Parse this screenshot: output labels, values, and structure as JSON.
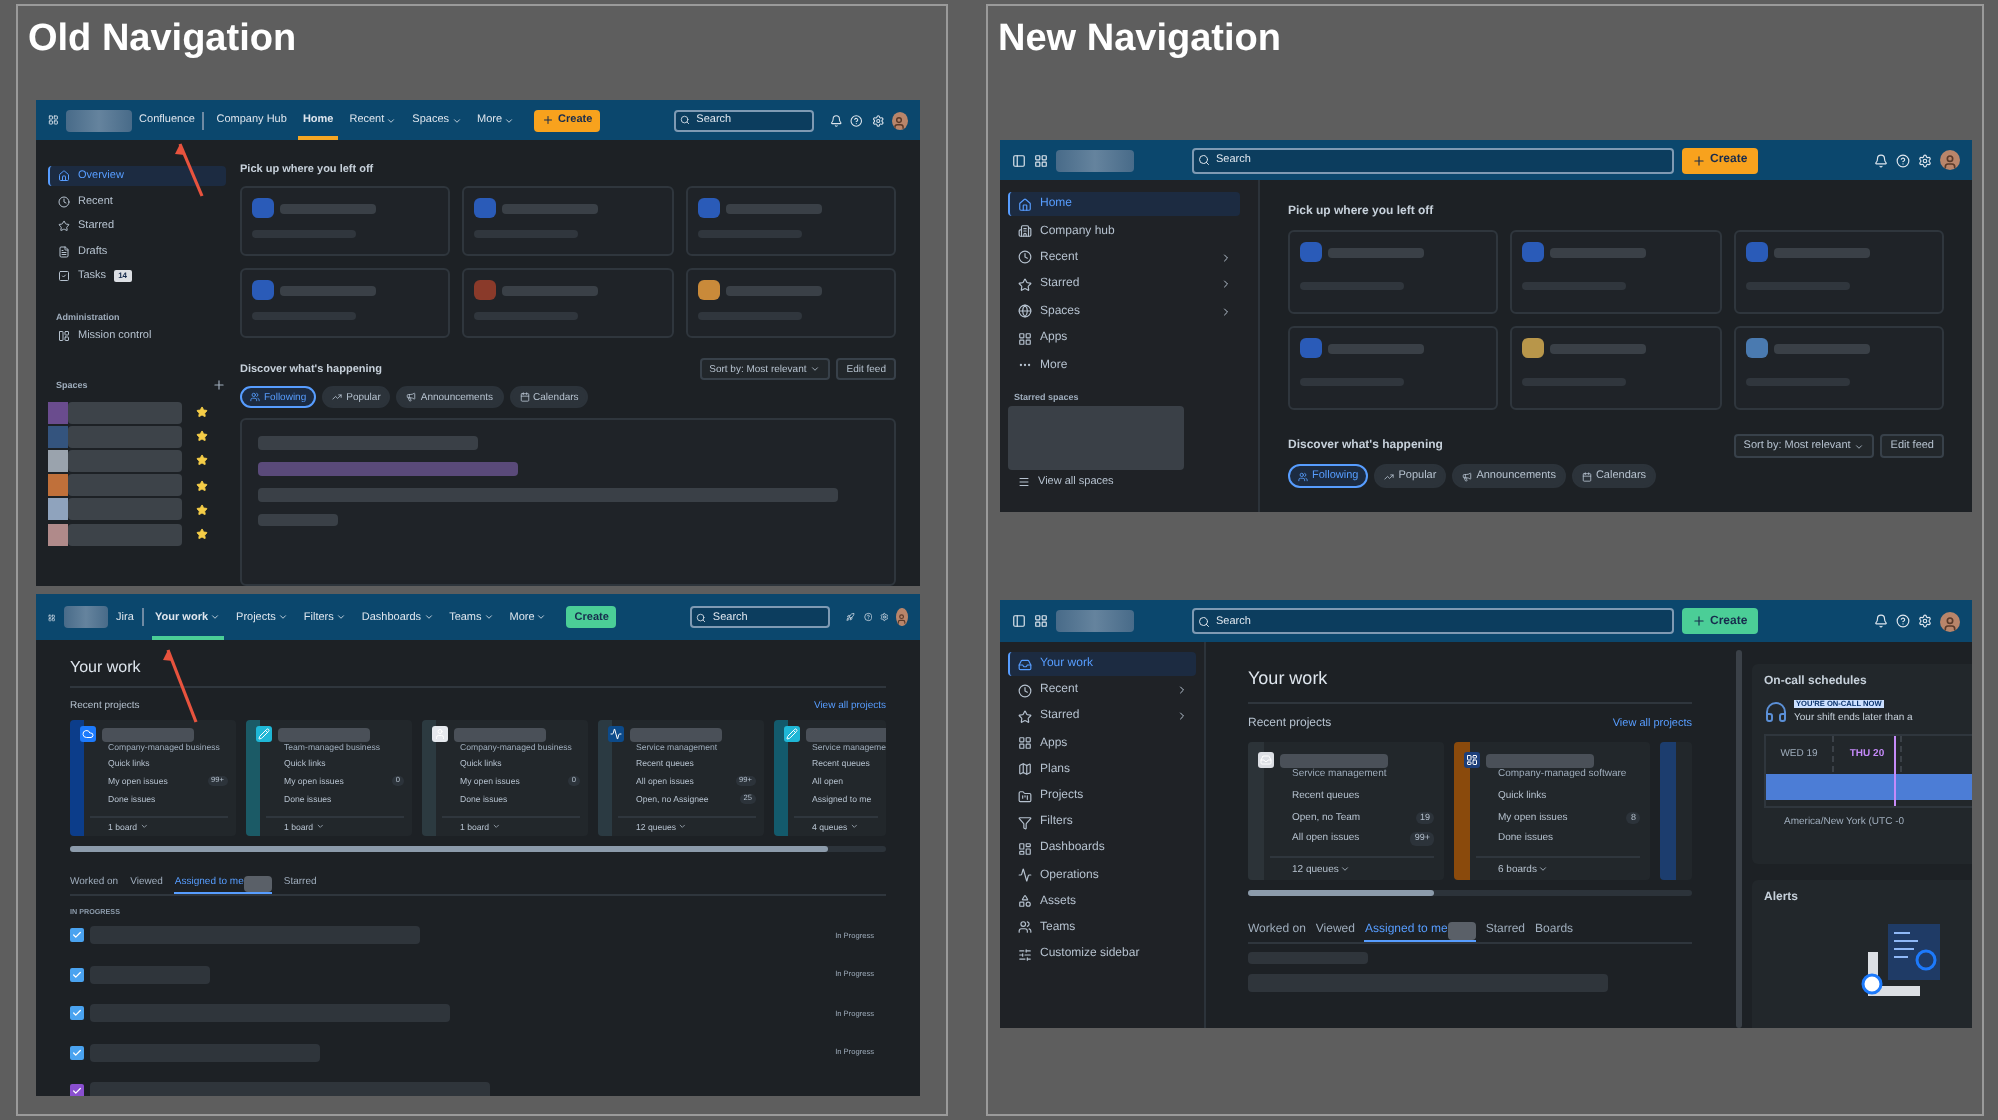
{
  "old_navigation": {
    "title": "Old Navigation",
    "confluence": {
      "top_nav": {
        "product": "Confluence",
        "items": [
          {
            "label": "Company Hub",
            "selected": false,
            "dropdown": false
          },
          {
            "label": "Home",
            "selected": true,
            "dropdown": false
          },
          {
            "label": "Recent",
            "selected": false,
            "dropdown": true
          },
          {
            "label": "Spaces",
            "selected": false,
            "dropdown": true
          },
          {
            "label": "More",
            "selected": false,
            "dropdown": true
          }
        ],
        "create": "Create",
        "search": {
          "placeholder": "Search"
        }
      },
      "sidebar": {
        "items": [
          {
            "label": "Overview",
            "selected": true
          },
          {
            "label": "Recent",
            "selected": false
          },
          {
            "label": "Starred",
            "selected": false
          },
          {
            "label": "Drafts",
            "selected": false
          },
          {
            "label": "Tasks",
            "selected": false,
            "badge": "14"
          }
        ],
        "admin_heading": "Administration",
        "admin_items": [
          {
            "label": "Mission control",
            "selected": false
          }
        ],
        "spaces_heading": "Spaces",
        "spaces": [
          {
            "color": "#6a4c8e",
            "starred": true
          },
          {
            "color": "#34547e",
            "starred": true
          },
          {
            "color": "#9aa3ad",
            "starred": true
          },
          {
            "color": "#c0703a",
            "starred": true
          },
          {
            "color": "#8fa3bd",
            "starred": true
          },
          {
            "color": "#b08a8a",
            "starred": true
          }
        ]
      },
      "main": {
        "recent_heading": "Pick up where you left off",
        "recent_cards": [
          {
            "color": "#2a5bb8"
          },
          {
            "color": "#2a5bb8"
          },
          {
            "color": "#2a5bb8"
          },
          {
            "color": "#2a5bb8"
          },
          {
            "color": "#8a3a2a"
          },
          {
            "color": "#c98a3a"
          }
        ],
        "discover_heading": "Discover what's happening",
        "sort": "Sort by: Most relevant",
        "edit_feed": "Edit feed",
        "filters": [
          {
            "label": "Following",
            "selected": true
          },
          {
            "label": "Popular",
            "selected": false
          },
          {
            "label": "Announcements",
            "selected": false
          },
          {
            "label": "Calendars",
            "selected": false
          }
        ]
      }
    },
    "jira": {
      "top_nav": {
        "product": "Jira",
        "items": [
          {
            "label": "Your work",
            "selected": true,
            "dropdown": true
          },
          {
            "label": "Projects",
            "selected": false,
            "dropdown": true
          },
          {
            "label": "Filters",
            "selected": false,
            "dropdown": true
          },
          {
            "label": "Dashboards",
            "selected": false,
            "dropdown": true
          },
          {
            "label": "Teams",
            "selected": false,
            "dropdown": true
          },
          {
            "label": "More",
            "selected": false,
            "dropdown": true
          }
        ],
        "create": "Create",
        "search": {
          "placeholder": "Search"
        }
      },
      "main": {
        "heading": "Your work",
        "recent_heading": "Recent projects",
        "view_all": "View all projects",
        "projects": [
          {
            "color": "#0c3d8a",
            "type": "Company-managed business",
            "rows": [
              {
                "label": "Quick links"
              },
              {
                "label": "My open issues",
                "count": "99+"
              },
              {
                "label": "Done issues"
              }
            ],
            "footer": "1 board"
          },
          {
            "color": "#1b5a66",
            "type": "Team-managed business",
            "rows": [
              {
                "label": "Quick links"
              },
              {
                "label": "My open issues",
                "count": "0"
              },
              {
                "label": "Done issues"
              }
            ],
            "footer": "1 board"
          },
          {
            "color": "#2c3a40",
            "type": "Company-managed business",
            "rows": [
              {
                "label": "Quick links"
              },
              {
                "label": "My open issues",
                "count": "0"
              },
              {
                "label": "Done issues"
              }
            ],
            "footer": "1 board"
          },
          {
            "color": "#2b3a42",
            "type": "Service management",
            "rows": [
              {
                "label": "Recent queues"
              },
              {
                "label": "All open issues",
                "count": "99+"
              },
              {
                "label": "Open, no Assignee",
                "count": "25"
              }
            ],
            "footer": "12 queues"
          },
          {
            "color": "#135a6c",
            "type": "Service manageme",
            "rows": [
              {
                "label": "Recent queues"
              },
              {
                "label": "All open"
              },
              {
                "label": "Assigned to me"
              }
            ],
            "footer": "4 queues"
          }
        ],
        "tabs": [
          {
            "label": "Worked on",
            "selected": false,
            "blurred_count": false
          },
          {
            "label": "Viewed",
            "selected": false,
            "blurred_count": false
          },
          {
            "label": "Assigned to me",
            "selected": true,
            "blurred_count": true
          },
          {
            "label": "Starred",
            "selected": false,
            "blurred_count": false
          }
        ],
        "section": "IN PROGRESS",
        "issues": [
          {
            "color": "#4aa3f0",
            "status": "In Progress"
          },
          {
            "color": "#4aa3f0",
            "status": "In Progress"
          },
          {
            "color": "#4aa3f0",
            "status": "In Progress"
          },
          {
            "color": "#4aa3f0",
            "status": "In Progress"
          },
          {
            "color": "#8a4fd0"
          }
        ]
      }
    }
  },
  "new_navigation": {
    "title": "New Navigation",
    "confluence": {
      "top_nav": {
        "search": {
          "placeholder": "Search"
        },
        "create": "Create"
      },
      "sidebar": {
        "items": [
          {
            "label": "Home",
            "selected": true,
            "expandable": false
          },
          {
            "label": "Company hub",
            "selected": false,
            "expandable": false
          },
          {
            "label": "Recent",
            "selected": false,
            "expandable": true
          },
          {
            "label": "Starred",
            "selected": false,
            "expandable": true
          },
          {
            "label": "Spaces",
            "selected": false,
            "expandable": true
          },
          {
            "label": "Apps",
            "selected": false,
            "expandable": false
          },
          {
            "label": "More",
            "selected": false,
            "expandable": false
          }
        ],
        "starred_heading": "Starred spaces",
        "view_all": "View all spaces"
      },
      "main": {
        "recent_heading": "Pick up where you left off",
        "recent_cards": [
          {
            "color": "#2a5bb8"
          },
          {
            "color": "#2a5bb8"
          },
          {
            "color": "#2a5bb8"
          },
          {
            "color": "#2a5bb8"
          },
          {
            "color": "#b8964a"
          },
          {
            "color": "#4a7ab0"
          }
        ],
        "discover_heading": "Discover what's happening",
        "sort": "Sort by: Most relevant",
        "edit_feed": "Edit feed",
        "filters": [
          {
            "label": "Following",
            "selected": true
          },
          {
            "label": "Popular",
            "selected": false
          },
          {
            "label": "Announcements",
            "selected": false
          },
          {
            "label": "Calendars",
            "selected": false
          }
        ]
      }
    },
    "jira": {
      "top_nav": {
        "search": {
          "placeholder": "Search"
        },
        "create": "Create"
      },
      "sidebar": {
        "items": [
          {
            "label": "Your work",
            "selected": true,
            "expandable": false
          },
          {
            "label": "Recent",
            "selected": false,
            "expandable": true
          },
          {
            "label": "Starred",
            "selected": false,
            "expandable": true
          },
          {
            "label": "Apps",
            "selected": false,
            "expandable": false
          },
          {
            "label": "Plans",
            "selected": false,
            "expandable": false
          },
          {
            "label": "Projects",
            "selected": false,
            "expandable": false
          },
          {
            "label": "Filters",
            "selected": false,
            "expandable": false
          },
          {
            "label": "Dashboards",
            "selected": false,
            "expandable": false
          },
          {
            "label": "Operations",
            "selected": false,
            "expandable": false
          },
          {
            "label": "Assets",
            "selected": false,
            "expandable": false
          },
          {
            "label": "Teams",
            "selected": false,
            "expandable": false
          },
          {
            "label": "Customize sidebar",
            "selected": false,
            "expandable": false
          }
        ]
      },
      "main": {
        "heading": "Your work",
        "recent_heading": "Recent projects",
        "view_all": "View all projects",
        "projects": [
          {
            "color": "#2c3338",
            "type": "Service management",
            "rows": [
              {
                "label": "Recent queues"
              },
              {
                "label": "Open, no Team",
                "count": "19"
              },
              {
                "label": "All open issues",
                "count": "99+"
              }
            ],
            "footer": "12 queues"
          },
          {
            "color": "#8a4a0c",
            "type": "Company-managed software",
            "rows": [
              {
                "label": "Quick links"
              },
              {
                "label": "My open issues",
                "count": "8"
              },
              {
                "label": "Done issues"
              }
            ],
            "footer": "6 boards"
          },
          {
            "color": "#1c3d6e"
          }
        ],
        "tabs": [
          {
            "label": "Worked on",
            "selected": false,
            "blurred_count": false
          },
          {
            "label": "Viewed",
            "selected": false,
            "blurred_count": false
          },
          {
            "label": "Assigned to me",
            "selected": true,
            "blurred_count": true
          },
          {
            "label": "Starred",
            "selected": false,
            "blurred_count": false
          },
          {
            "label": "Boards",
            "selected": false,
            "blurred_count": false
          }
        ]
      },
      "on_call": {
        "title": "On-call schedules",
        "badge": "YOU'RE ON-CALL NOW",
        "message": "Your shift ends later than a",
        "days": [
          {
            "label": "WED 19",
            "selected": false
          },
          {
            "label": "THU 20",
            "selected": true
          }
        ],
        "timezone": "America/New York (UTC -0"
      },
      "alerts": {
        "title": "Alerts"
      }
    }
  }
}
